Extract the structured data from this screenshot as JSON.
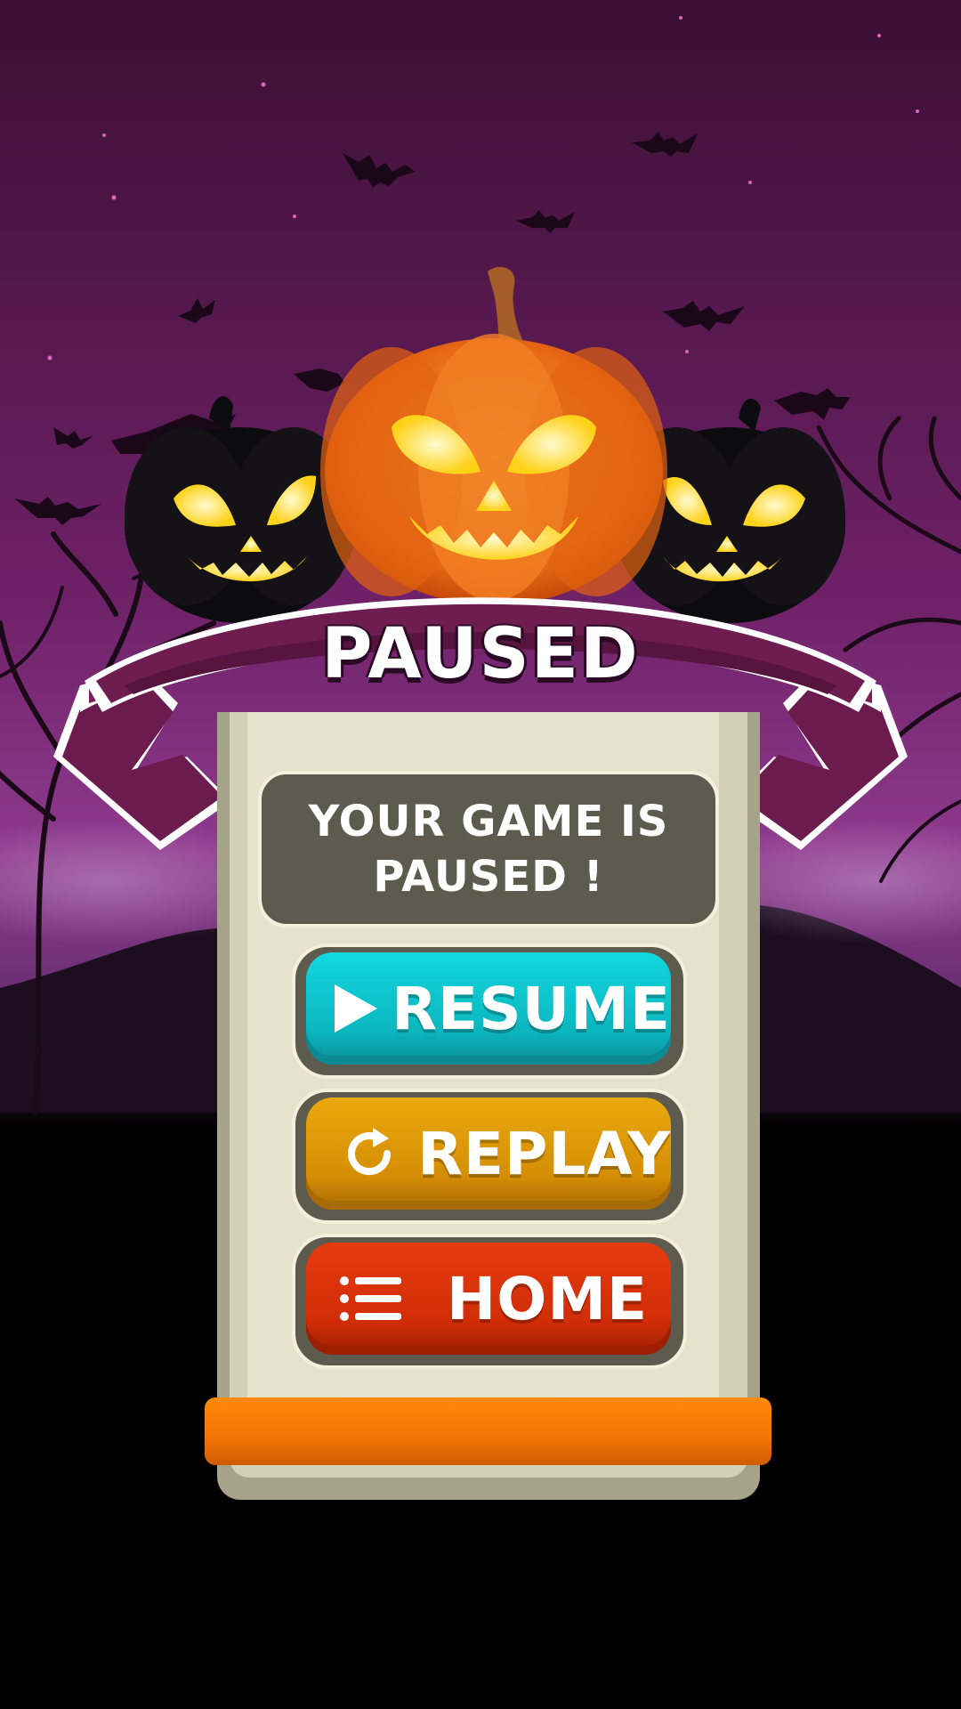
{
  "screen": {
    "title": "PAUSED",
    "message": "YOUR GAME IS PAUSED !"
  },
  "buttons": {
    "resume": {
      "label": "RESUME",
      "icon": "play-icon",
      "color": "#12d8e0"
    },
    "replay": {
      "label": "REPLAY",
      "icon": "replay-icon",
      "color": "#e9a90d"
    },
    "home": {
      "label": "HOME",
      "icon": "menu-list-icon",
      "color": "#e63b10"
    }
  },
  "theme": {
    "sky_top": "#3b0f33",
    "sky_mid": "#8a2f8a",
    "ribbon": "#6d1f4f",
    "accent_orange": "#f27406"
  }
}
